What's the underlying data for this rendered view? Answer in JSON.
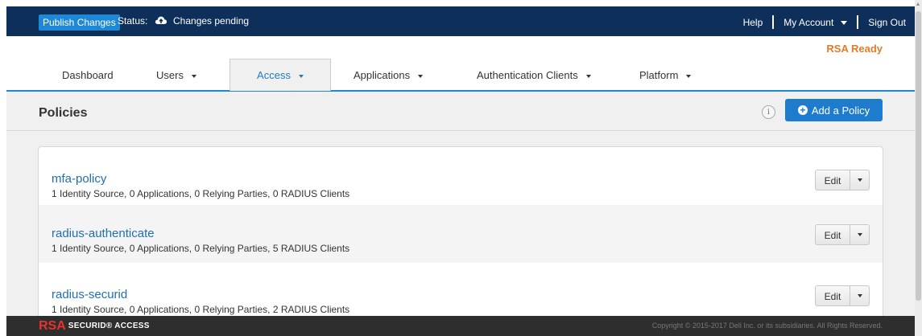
{
  "topbar": {
    "publish_label": "Publish Changes",
    "status_label": "Status:",
    "status_icon": "cloud-upload-icon",
    "status_value": "Changes pending",
    "help_label": "Help",
    "account_label": "My Account",
    "signout_label": "Sign Out"
  },
  "rsa_ready": "RSA Ready",
  "tabs": [
    {
      "label": "Dashboard",
      "has_menu": false
    },
    {
      "label": "Users",
      "has_menu": true
    },
    {
      "label": "Access",
      "has_menu": true,
      "active": true
    },
    {
      "label": "Applications",
      "has_menu": true
    },
    {
      "label": "Authentication Clients",
      "has_menu": true
    },
    {
      "label": "Platform",
      "has_menu": true
    }
  ],
  "page": {
    "title": "Policies",
    "info_icon": "i",
    "add_label": "Add a Policy"
  },
  "policies": [
    {
      "name": "mfa-policy",
      "desc": "1 Identity Source, 0 Applications, 0 Relying Parties, 0 RADIUS Clients",
      "edit_label": "Edit"
    },
    {
      "name": "radius-authenticate",
      "desc": "1 Identity Source, 0 Applications, 0 Relying Parties, 5 RADIUS Clients",
      "edit_label": "Edit"
    },
    {
      "name": "radius-securid",
      "desc": "1 Identity Source, 0 Applications, 0 Relying Parties, 2 RADIUS Clients",
      "edit_label": "Edit"
    }
  ],
  "footer": {
    "logo_mark": "RSA",
    "logo_text": "SECURID® ACCESS",
    "copyright": "Copyright © 2015-2017 Dell Inc. or its subsidiaries. All Rights Reserved."
  },
  "colors": {
    "topbar_bg": "#0e2f5a",
    "accent": "#1e88d6",
    "rsa_ready": "#e47b25",
    "link": "#1f6fb0",
    "footer_bg": "#2e2e2e"
  }
}
